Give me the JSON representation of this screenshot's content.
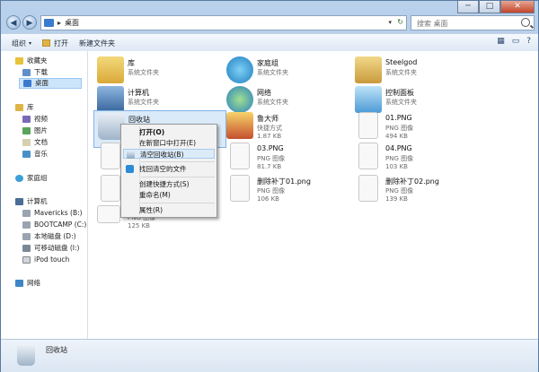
{
  "window": {
    "minimize": "─",
    "maximize": "□",
    "close": "✕"
  },
  "address": {
    "back": "◀",
    "forward": "▶",
    "separator": "▸",
    "crumb": "桌面",
    "dropdown": "▾",
    "refresh": "↻"
  },
  "search": {
    "placeholder": "搜索 桌面"
  },
  "toolbar": {
    "organize": "组织",
    "open": "打开",
    "new_folder": "新建文件夹",
    "arrow": "▾",
    "view_icon": "▦",
    "pane_icon": "▭",
    "help_icon": "?"
  },
  "sidebar": {
    "favorites": "收藏夹",
    "downloads": "下载",
    "desktop": "桌面",
    "libraries": "库",
    "videos": "视频",
    "pictures": "图片",
    "documents": "文档",
    "music": "音乐",
    "homegroup": "家庭组",
    "computer": "计算机",
    "drives": [
      "Mavericks (B:)",
      "BOOTCAMP (C:)",
      "本地磁盘 (D:)",
      "可移动磁盘 (I:)",
      "iPod touch"
    ],
    "network": "网络"
  },
  "files": [
    {
      "name": "库",
      "type": "系统文件夹",
      "size": ""
    },
    {
      "name": "家庭组",
      "type": "系统文件夹",
      "size": ""
    },
    {
      "name": "Steelgod",
      "type": "系统文件夹",
      "size": ""
    },
    {
      "name": "计算机",
      "type": "系统文件夹",
      "size": ""
    },
    {
      "name": "网络",
      "type": "系统文件夹",
      "size": ""
    },
    {
      "name": "控制面板",
      "type": "系统文件夹",
      "size": ""
    },
    {
      "name": "回收站",
      "type": "系统文件夹",
      "size": ""
    },
    {
      "name": "鲁大师",
      "type": "快捷方式",
      "size": "1.87 KB"
    },
    {
      "name": "01.PNG",
      "type": "PNG 图像",
      "size": "494 KB"
    },
    {
      "name": "03.PNG",
      "type": "PNG 图像",
      "size": "81.7 KB"
    },
    {
      "name": "04.PNG",
      "type": "PNG 图像",
      "size": "103 KB"
    },
    {
      "name": "删除补丁01.png",
      "type": "PNG 图像",
      "size": "106 KB"
    },
    {
      "name": "删除补丁02.png",
      "type": "PNG 图像",
      "size": "139 KB"
    },
    {
      "name": "",
      "type": "PNG 图像",
      "size": "125 KB"
    }
  ],
  "context_menu": {
    "open": "打开(O)",
    "open_new_window": "在新窗口中打开(E)",
    "empty_bin": "清空回收站(B)",
    "recover": "找回清空的文件",
    "create_shortcut": "创建快捷方式(S)",
    "rename": "重命名(M)",
    "properties": "属性(R)"
  },
  "status": {
    "selected_name": "回收站"
  }
}
